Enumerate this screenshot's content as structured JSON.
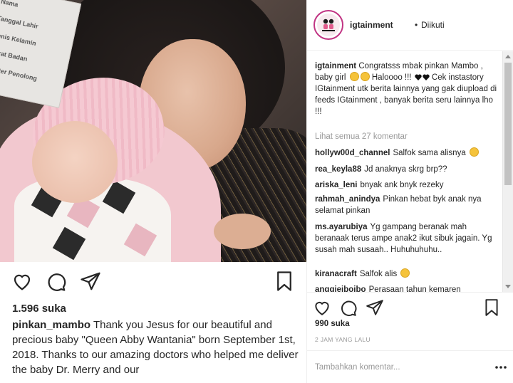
{
  "background_post": {
    "photo_text": [
      "Nama",
      "Tanggal Lahir",
      "Jenis Kelamin",
      "Berat Badan",
      "Dokter Penolong"
    ],
    "likes": "1.596 suka",
    "caption_user": "pinkan_mambo",
    "caption_text": "Thank you Jesus for our beautiful and precious baby \"Queen Abby Wantania\" born September 1st, 2018. Thanks to our amazing doctors who helped me deliver the baby Dr. Merry and our"
  },
  "panel": {
    "header": {
      "username": "igtainment",
      "separator": "•",
      "follow_status": "Diikuti"
    },
    "caption": {
      "user": "igtainment",
      "text_1": "Congratsss mbak pinkan Mambo , baby girl",
      "text_2": "Haloooo !!!",
      "text_3": "Cek instastory IGtainment utk berita lainnya yang gak diupload di feeds IGtainment , banyak berita seru lainnya lho !!!"
    },
    "view_all": "Lihat semua 27 komentar",
    "comments": [
      {
        "user": "hollyw00d_channel",
        "text": "Salfok sama alisnya"
      },
      {
        "user": "rea_keyla88",
        "text": "Jd anaknya skrg brp??"
      },
      {
        "user": "ariska_leni",
        "text": "bnyak ank bnyk rezeky"
      },
      {
        "user": "rahmah_anindya",
        "text": "Pinkan hebat byk anak nya selamat pinkan"
      },
      {
        "user": "ms.ayarubiya",
        "text": "Yg gampang beranak mah beranaak terus ampe anak2 ikut sibuk jagain. Yg susah mah susaah.. Huhuhuhuhu.."
      },
      {
        "user": "kiranacraft",
        "text": "Salfok alis"
      },
      {
        "user": "anggieibojbo",
        "text": "Perasaan tahun kemaren"
      }
    ],
    "likes": "990 suka",
    "time": "2 JAM YANG LALU",
    "comment_placeholder": "Tambahkan komentar..."
  },
  "icons": [
    "heart-icon",
    "comment-icon",
    "share-icon",
    "bookmark-icon",
    "more-options-icon"
  ],
  "colors": {
    "text": "#262626",
    "muted": "#999999",
    "border": "#efefef",
    "avatar_ring": "#c13584"
  }
}
